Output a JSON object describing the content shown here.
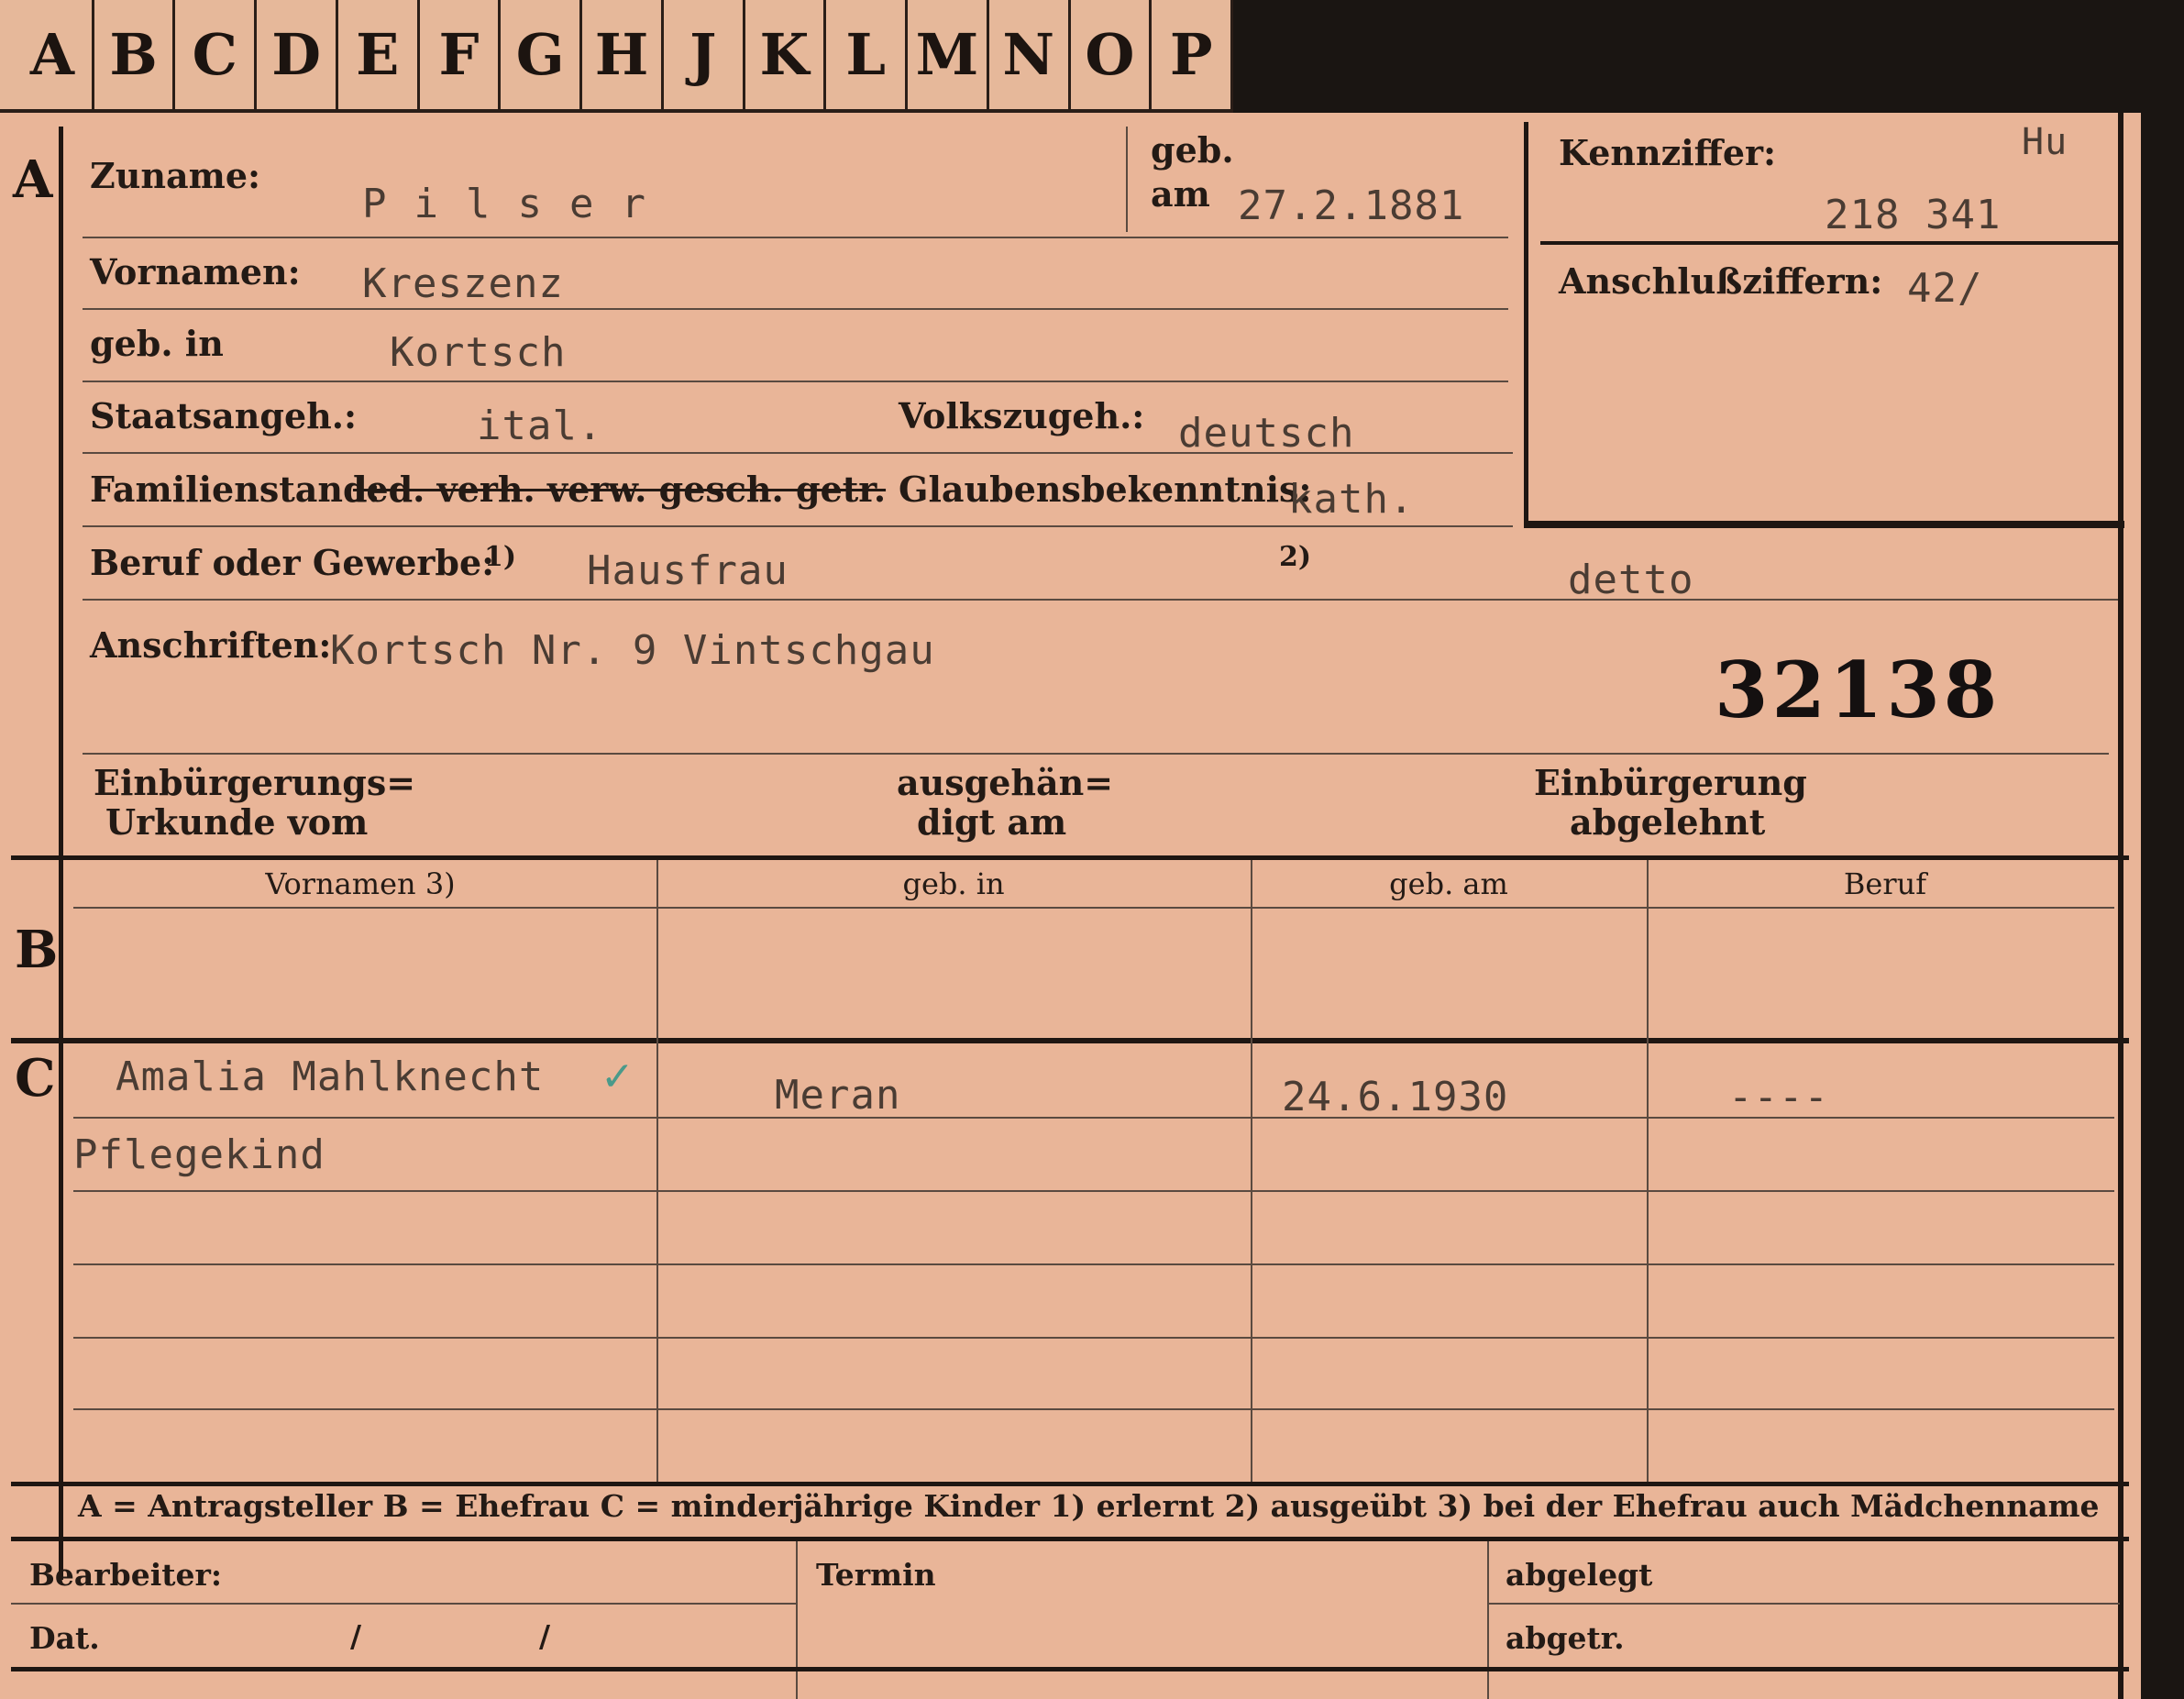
{
  "tabs": [
    "A",
    "B",
    "C",
    "D",
    "E",
    "F",
    "G",
    "H",
    "J",
    "K",
    "L",
    "M",
    "N",
    "O",
    "P"
  ],
  "section_labels": {
    "a": "A",
    "b": "B",
    "c": "C"
  },
  "section_a": {
    "surname_label": "Zuname:",
    "surname": "Pilser",
    "born_label": "geb.",
    "born_on_label": "am",
    "born_date": "27.2.1881",
    "given_names_label": "Vornamen:",
    "given_names": "Kreszenz",
    "birthplace_label": "geb. in",
    "birthplace": "Kortsch",
    "citizenship_label": "Staatsangeh.:",
    "citizenship": "ital.",
    "ethnicity_label": "Volkszugeh.:",
    "ethnicity": "deutsch",
    "marital_label": "Familienstand:",
    "marital_options": "led. verh. verw. gesch. getr.",
    "religion_label": "Glaubensbekenntnis:",
    "religion": "kath.",
    "occupation_label": "Beruf oder Gewerbe:",
    "occupation_note1": "1)",
    "occupation": "Hausfrau",
    "occupation_note2": "2)",
    "occupation2": "detto",
    "address_label": "Anschriften:",
    "address": "Kortsch Nr. 9 Vintschgau",
    "file_number": "32138",
    "naturalization_label_1": "Einbürgerungs=",
    "naturalization_label_2": "Urkunde vom",
    "handed_label_1": "ausgehän=",
    "handed_label_2": "digt am",
    "rejected_label_1": "Einbürgerung",
    "rejected_label_2": "abgelehnt"
  },
  "id_box": {
    "code_label": "Kennziffer:",
    "code_prefix": "Hu",
    "code": "218 341",
    "connection_label": "Anschlußziffern:",
    "connection": "42/"
  },
  "table_headers": [
    "Vornamen 3)",
    "geb. in",
    "geb. am",
    "Beruf"
  ],
  "section_c_rows": [
    {
      "name": "Amalia Mahlknecht",
      "place": "Meran",
      "date": "24.6.1930",
      "job": "----",
      "note": "Pflegekind"
    }
  ],
  "legend": "A = Antragsteller   B = Ehefrau   C = minderjährige Kinder   1) erlernt   2) ausgeübt   3) bei der Ehefrau auch Mädchenname",
  "footer": {
    "clerk_label": "Bearbeiter:",
    "date_label": "Dat.",
    "date_sep1": "/",
    "date_sep2": "/",
    "deadline_label": "Termin",
    "filed_label": "abgelegt",
    "sent_label": "abgetr."
  },
  "colors": {
    "card": "#e9b598",
    "ink": "#231a15",
    "typewriter": "#4a3c33",
    "check": "#4a9a8a"
  }
}
